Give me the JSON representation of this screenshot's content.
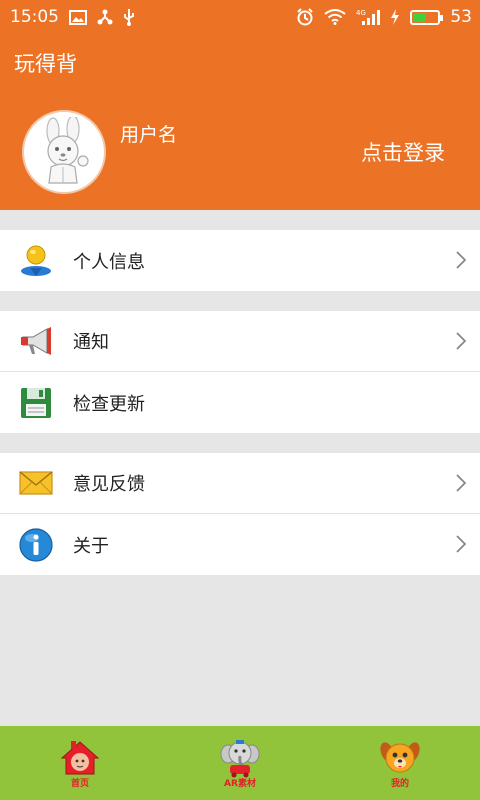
{
  "status_bar": {
    "time": "15:05",
    "network": "4G",
    "battery": "53"
  },
  "header": {
    "app_title": "玩得背",
    "username": "用户名",
    "login_label": "点击登录"
  },
  "menu": {
    "group1": [
      {
        "label": "个人信息",
        "icon": "person-location-icon",
        "chevron": true
      }
    ],
    "group2": [
      {
        "label": "通知",
        "icon": "megaphone-icon",
        "chevron": true
      },
      {
        "label": "检查更新",
        "icon": "floppy-disk-icon",
        "chevron": false
      }
    ],
    "group3": [
      {
        "label": "意见反馈",
        "icon": "envelope-icon",
        "chevron": true
      },
      {
        "label": "关于",
        "icon": "info-icon",
        "chevron": true
      }
    ]
  },
  "bottom_nav": [
    {
      "label": "首页",
      "icon": "house-icon"
    },
    {
      "label": "AR素材",
      "icon": "elephant-icon"
    },
    {
      "label": "我的",
      "icon": "dog-icon"
    }
  ],
  "colors": {
    "header": "#ec7325",
    "bottom_nav": "#91c33b",
    "background": "#e6e6e6"
  }
}
